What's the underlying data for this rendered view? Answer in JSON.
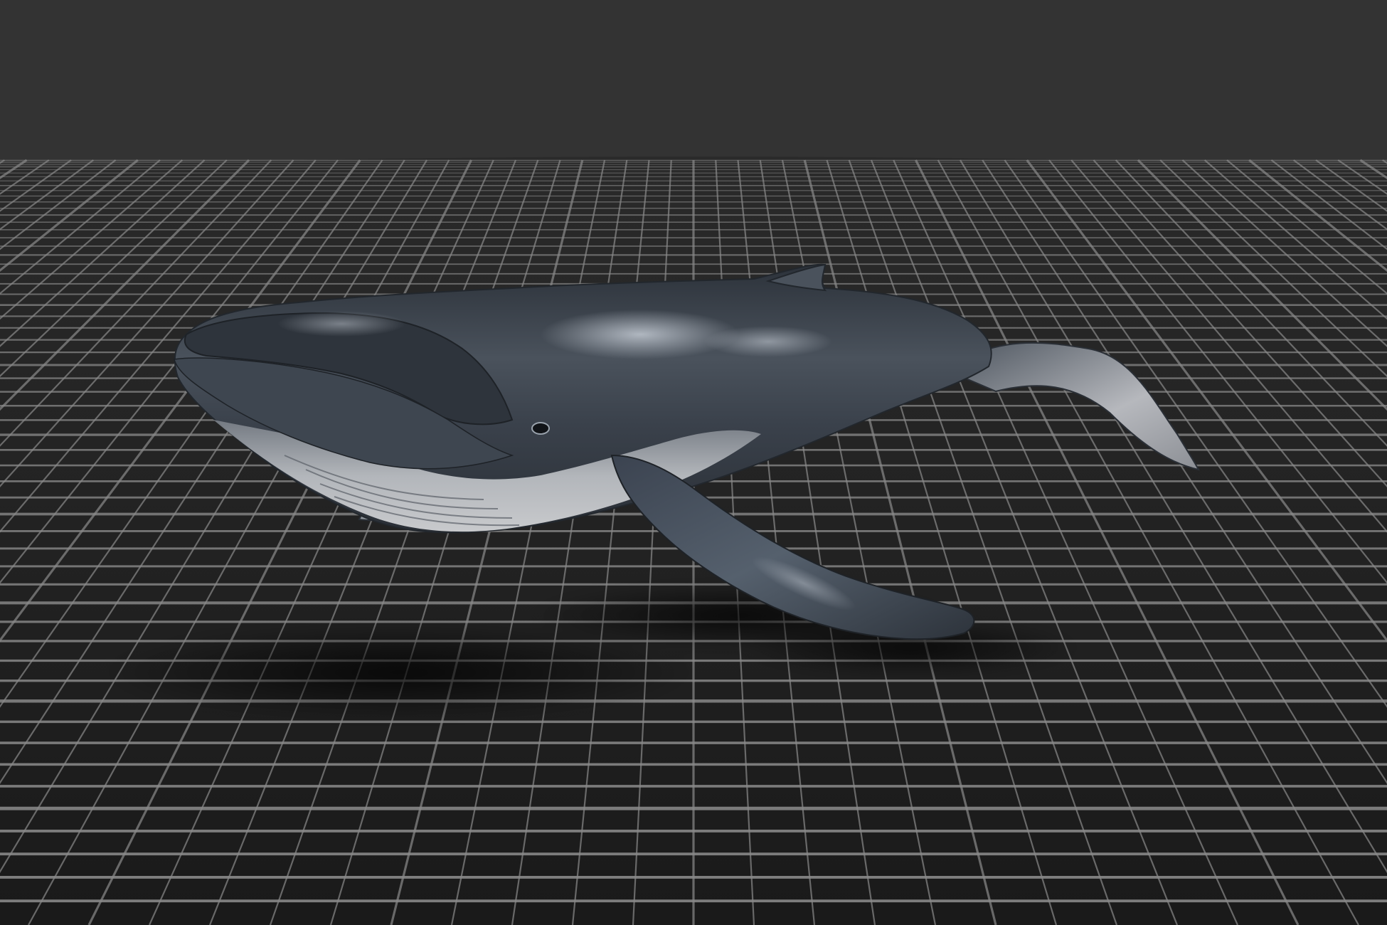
{
  "viewport": {
    "background_color": "#333333",
    "ground_color": "#1f1f1f",
    "grid_color": "#8a8a8a",
    "shadow_color": "#0e0e0e"
  },
  "model": {
    "subject": "humpback-whale",
    "body_color": "#3a414b",
    "belly_color": "#c9ccd0",
    "highlight_color": "#9aa3ad"
  }
}
